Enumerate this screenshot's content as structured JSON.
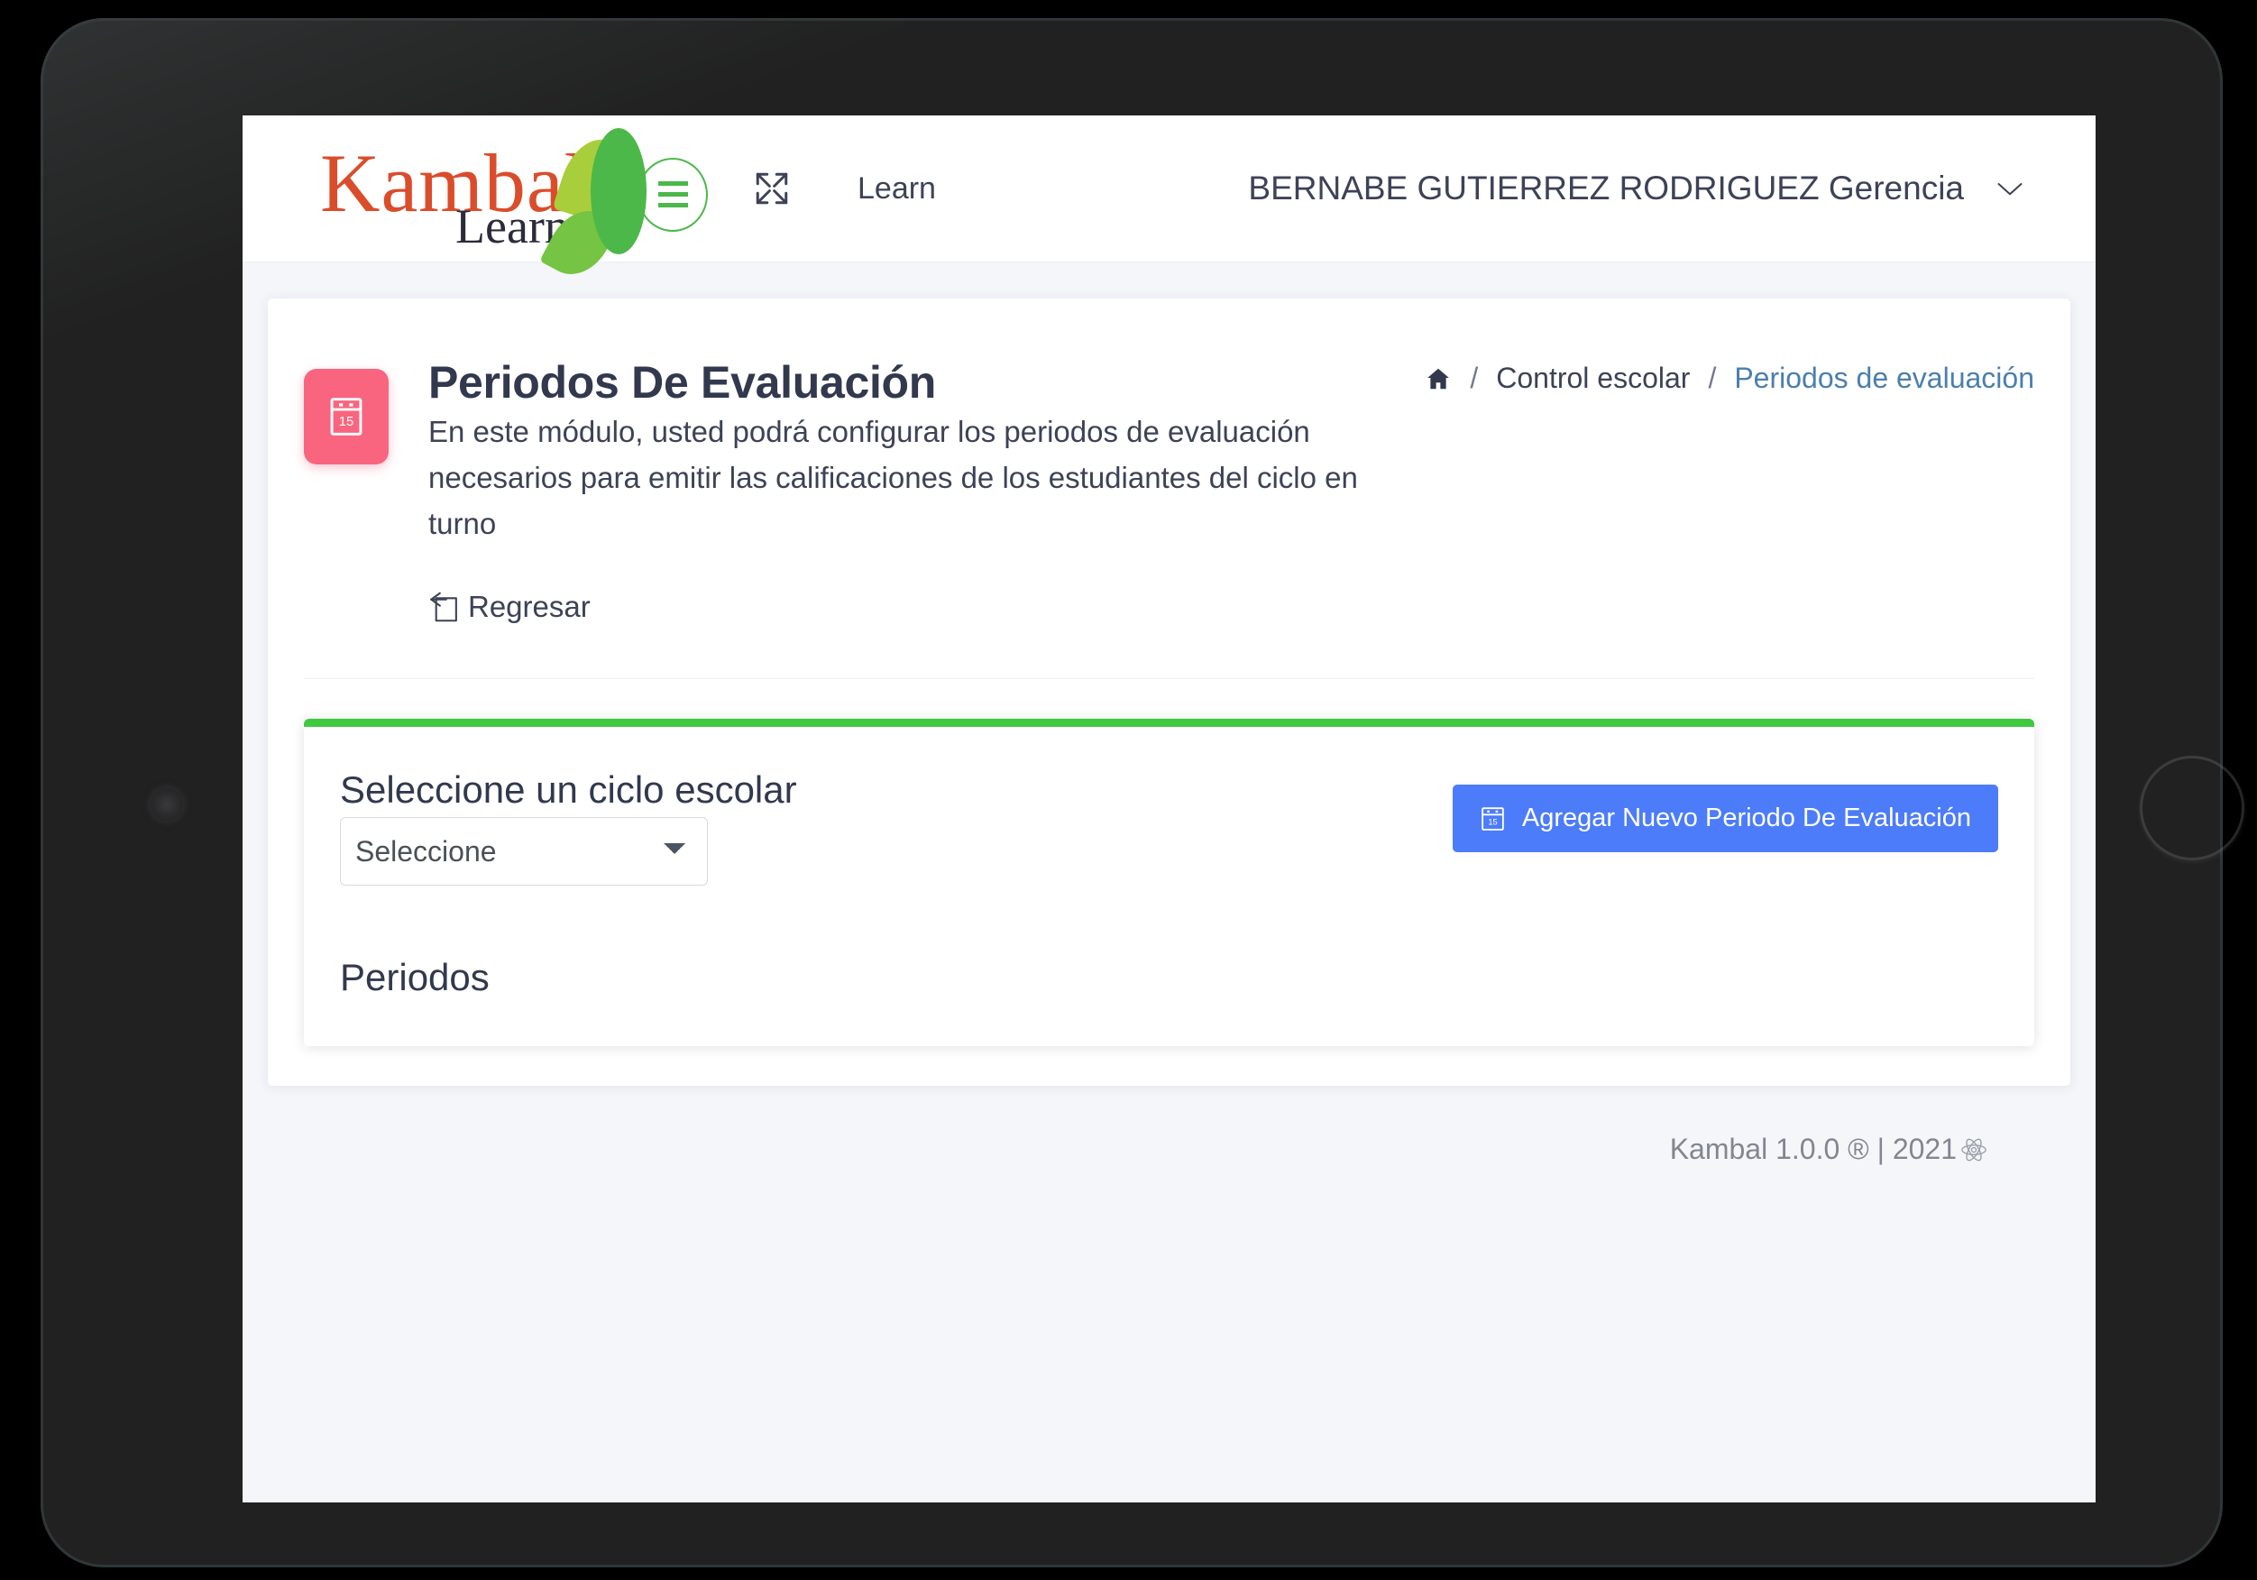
{
  "navbar": {
    "logo_word": "Kambal",
    "logo_sub": "Learn",
    "expand_icon": "expand-fullscreen-icon",
    "nav_link": "Learn",
    "user_name": "BERNABE GUTIERREZ RODRIGUEZ Gerencia",
    "caret_icon": "chevron-down-icon"
  },
  "module": {
    "icon": "calendar-15-icon",
    "title": "Periodos De Evaluación",
    "desc_line_1": "En este módulo, usted podrá configurar los periodos de evaluación",
    "desc_line_2": "necesarios para emitir las calificaciones de los estudiantes del ciclo en turno",
    "back_label": "Regresar",
    "back_icon": "undo-arrow-icon"
  },
  "breadcrumb": {
    "home_icon": "home-icon",
    "sep": "/",
    "parent": "Control escolar",
    "current": "Periodos de evaluación"
  },
  "form": {
    "cycle_label": "Seleccione un ciclo escolar",
    "cycle_selected": "Seleccione",
    "cycle_options": [
      "Seleccione"
    ],
    "add_button_label": "Agregar Nuevo Periodo De Evaluación",
    "add_button_icon": "calendar-plus-icon",
    "periods_title": "Periodos"
  },
  "footer": {
    "text": "Kambal 1.0.0 ® | 2021",
    "icon": "atom-react-icon"
  },
  "colors": {
    "accent_green": "#3ec93e",
    "accent_blue": "#4c7cf9",
    "module_icon_pink": "#f9657f",
    "logo_orange": "#da4d2b",
    "logo_green": "#4cb849",
    "page_bg": "#f4f6fa",
    "text_dark": "#32394e",
    "breadcrumb_current": "#4a7fae"
  }
}
